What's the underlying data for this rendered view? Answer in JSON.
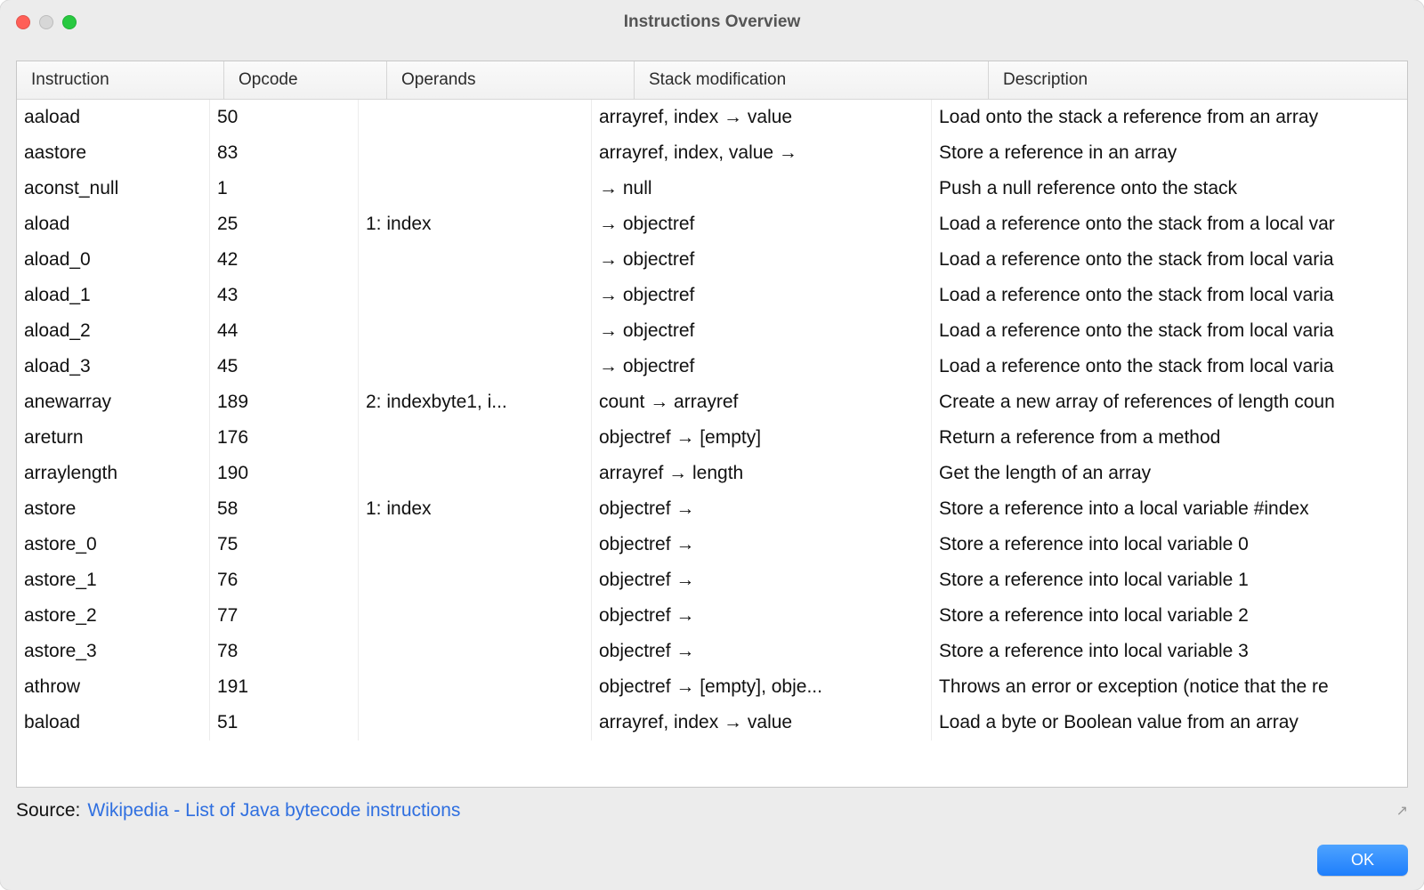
{
  "window": {
    "title": "Instructions Overview"
  },
  "table": {
    "headers": {
      "instruction": "Instruction",
      "opcode": "Opcode",
      "operands": "Operands",
      "stack": "Stack modification",
      "description": "Description"
    },
    "rows": [
      {
        "instruction": "aaload",
        "opcode": "50",
        "operands": "",
        "stack": "arrayref, index → value",
        "description": "Load onto the stack a reference from an array"
      },
      {
        "instruction": "aastore",
        "opcode": "83",
        "operands": "",
        "stack": "arrayref, index, value →",
        "description": "Store a reference in an array"
      },
      {
        "instruction": "aconst_null",
        "opcode": "1",
        "operands": "",
        "stack": "→ null",
        "description": "Push a null reference onto the stack"
      },
      {
        "instruction": "aload",
        "opcode": "25",
        "operands": "1: index",
        "stack": "→ objectref",
        "description": "Load a reference onto the stack from a local var"
      },
      {
        "instruction": "aload_0",
        "opcode": "42",
        "operands": "",
        "stack": "→ objectref",
        "description": "Load a reference onto the stack from local varia"
      },
      {
        "instruction": "aload_1",
        "opcode": "43",
        "operands": "",
        "stack": "→ objectref",
        "description": "Load a reference onto the stack from local varia"
      },
      {
        "instruction": "aload_2",
        "opcode": "44",
        "operands": "",
        "stack": "→ objectref",
        "description": "Load a reference onto the stack from local varia"
      },
      {
        "instruction": "aload_3",
        "opcode": "45",
        "operands": "",
        "stack": "→ objectref",
        "description": "Load a reference onto the stack from local varia"
      },
      {
        "instruction": "anewarray",
        "opcode": "189",
        "operands": "2: indexbyte1, i...",
        "stack": "count → arrayref",
        "description": "Create a new array of references of length coun"
      },
      {
        "instruction": "areturn",
        "opcode": "176",
        "operands": "",
        "stack": "objectref → [empty]",
        "description": "Return a reference from a method"
      },
      {
        "instruction": "arraylength",
        "opcode": "190",
        "operands": "",
        "stack": "arrayref → length",
        "description": "Get the length of an array"
      },
      {
        "instruction": "astore",
        "opcode": "58",
        "operands": "1: index",
        "stack": "objectref →",
        "description": "Store a reference into a local variable #index"
      },
      {
        "instruction": "astore_0",
        "opcode": "75",
        "operands": "",
        "stack": "objectref →",
        "description": "Store a reference into local variable 0"
      },
      {
        "instruction": "astore_1",
        "opcode": "76",
        "operands": "",
        "stack": "objectref →",
        "description": "Store a reference into local variable 1"
      },
      {
        "instruction": "astore_2",
        "opcode": "77",
        "operands": "",
        "stack": "objectref →",
        "description": "Store a reference into local variable 2"
      },
      {
        "instruction": "astore_3",
        "opcode": "78",
        "operands": "",
        "stack": "objectref →",
        "description": "Store a reference into local variable 3"
      },
      {
        "instruction": "athrow",
        "opcode": "191",
        "operands": "",
        "stack": "objectref → [empty], obje...",
        "description": "Throws an error or exception (notice that the re"
      },
      {
        "instruction": "baload",
        "opcode": "51",
        "operands": "",
        "stack": "arrayref, index → value",
        "description": "Load a byte or Boolean value from an array"
      }
    ]
  },
  "footer": {
    "source_label": "Source:",
    "source_link_text": "Wikipedia - List of Java bytecode instructions"
  },
  "buttons": {
    "ok": "OK"
  }
}
